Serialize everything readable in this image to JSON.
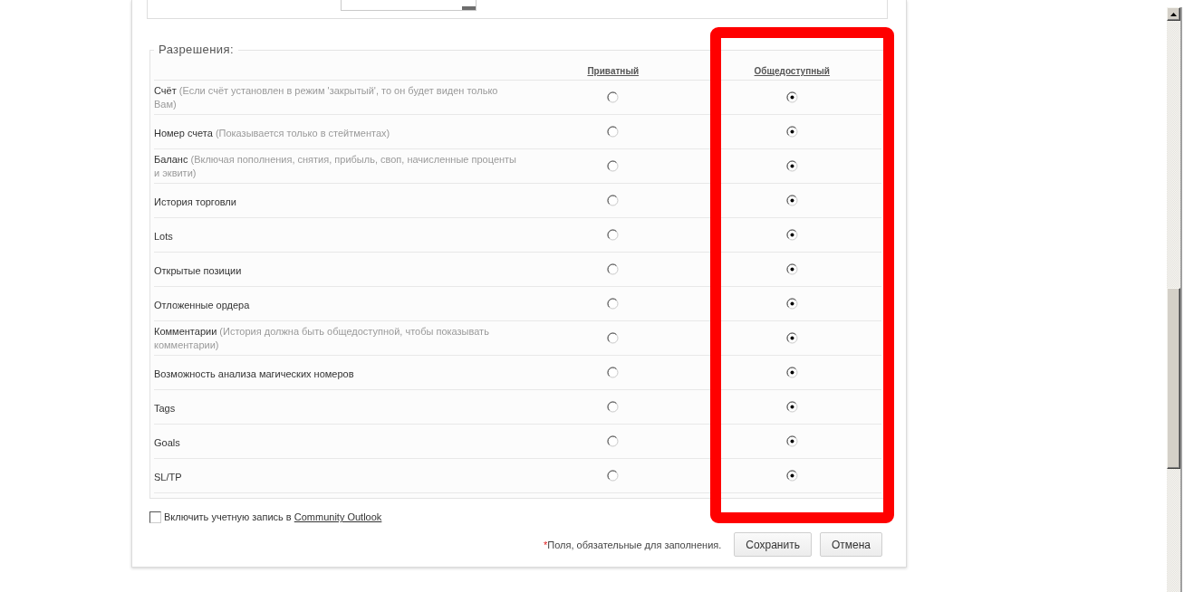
{
  "permissions": {
    "legend": "Разрешения:",
    "columns": [
      "Приватный",
      "Общедоступный"
    ],
    "rows": [
      {
        "name": "Счёт",
        "note": "(Если счёт установлен в режим 'закрытый', то он будет виден только Вам)",
        "options": [
          {
            "selected": false
          },
          {
            "selected": true
          }
        ]
      },
      {
        "name": "Номер счета",
        "note": "(Показывается только в стейтментах)",
        "options": [
          {
            "selected": false
          },
          {
            "selected": true
          }
        ]
      },
      {
        "name": "Баланс",
        "note": "(Включая пополнения, снятия, прибыль, своп, начисленные проценты и эквити)",
        "options": [
          {
            "selected": false
          },
          {
            "selected": true
          }
        ]
      },
      {
        "name": "История торговли",
        "options": [
          {
            "selected": false
          },
          {
            "selected": true
          }
        ]
      },
      {
        "name": "Lots",
        "options": [
          {
            "selected": false
          },
          {
            "selected": true
          }
        ]
      },
      {
        "name": "Открытые позиции",
        "options": [
          {
            "selected": false
          },
          {
            "selected": true
          }
        ]
      },
      {
        "name": "Отложенные ордера",
        "options": [
          {
            "selected": false
          },
          {
            "selected": true
          }
        ]
      },
      {
        "name": "Комментарии",
        "note": "(История должна быть общедоступной, чтобы показывать комментарии)",
        "options": [
          {
            "selected": false
          },
          {
            "selected": true
          }
        ]
      },
      {
        "name": "Возможность анализа магических номеров",
        "options": [
          {
            "selected": false
          },
          {
            "selected": true
          }
        ]
      },
      {
        "name": "Tags",
        "options": [
          {
            "selected": false
          },
          {
            "selected": true
          }
        ]
      },
      {
        "name": "Goals",
        "options": [
          {
            "selected": false
          },
          {
            "selected": true
          }
        ]
      },
      {
        "name": "SL/TP",
        "options": [
          {
            "selected": false
          },
          {
            "selected": true
          }
        ]
      }
    ]
  },
  "outlook": {
    "checked": false,
    "label": "Включить учетную запись в",
    "link": "Community Outlook"
  },
  "footer": {
    "required_mark": "*",
    "required_text": "Поля, обязательные для заполнения.",
    "buttons": [
      {
        "label": "Сохранить"
      },
      {
        "label": "Отмена"
      }
    ]
  }
}
